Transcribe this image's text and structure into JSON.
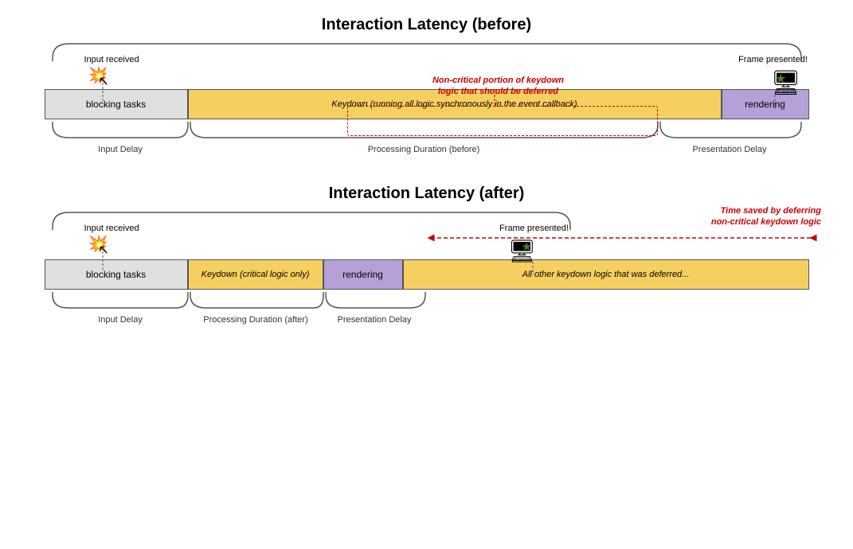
{
  "top": {
    "title": "Interaction Latency (before)",
    "input_received": "Input received",
    "frame_presented": "Frame presented!",
    "bar_blocking": "blocking tasks",
    "bar_keydown": "Keydown (running all logic synchronously in the event callback)",
    "bar_rendering": "rendering",
    "input_delay_label": "Input Delay",
    "processing_duration_label": "Processing Duration (before)",
    "presentation_delay_label": "Presentation Delay",
    "dashed_annotation": "Non-critical portion of keydown\nlogic that should be deferred"
  },
  "bottom": {
    "title": "Interaction Latency (after)",
    "input_received": "Input received",
    "frame_presented": "Frame presented!",
    "bar_blocking": "blocking tasks",
    "bar_keydown": "Keydown (critical logic only)",
    "bar_rendering": "rendering",
    "bar_deferred": "All other keydown logic that was deferred...",
    "input_delay_label": "Input Delay",
    "processing_duration_label": "Processing Duration (after)",
    "presentation_delay_label": "Presentation Delay",
    "time_saved_label": "Time saved by deferring\nnon-critical keydown logic"
  },
  "colors": {
    "blocking": "#e0e0e0",
    "keydown": "#f5d060",
    "rendering": "#b5a0d8",
    "deferred": "#f5d060",
    "red_annotation": "#cc0000"
  }
}
